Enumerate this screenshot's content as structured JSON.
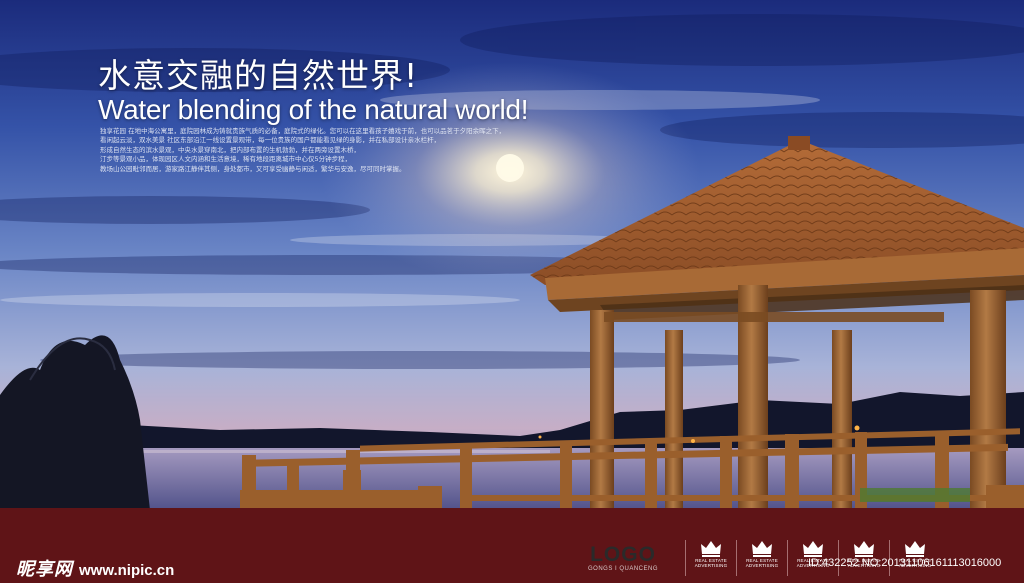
{
  "headline": {
    "title_cn": "水意交融的自然世界!",
    "title_en": "Water blending of the natural world!"
  },
  "body_text": [
    "独享花园 在地中海公寓里，庭院园林成为铸就贵族气质的必备，庭院式的绿化。您可以在这里看孩子嬉戏于前，也可以品茗于夕阳余晖之下，",
    "看闲起云淡，双水美景 社区东部沿江一线设置景观带，每一位贵族的国户都能看见绿的身影，并在私部设计亲水栏杆，",
    "形成自然生态的滨水景观，中央水景穿南北，把内部布置的生机勃勃，并在两旁设置木桥，",
    "汀步等景观小品，体现园区人文内涵和生活意境，稀有地段距离城市中心仅5分钟步程，",
    "教场山公园毗邻而居，游家路江静伴其侧，身处都市，又可享受幽静与闲适，繁华与安逸，尽可同时掌握。"
  ],
  "footer": {
    "site_cn": "昵享网",
    "site_url": "www.nipic.cn",
    "logo_word": "LOGO",
    "logo_sub": "GONGS I QUANCENG",
    "badges": [
      {
        "icon": "crown-icon",
        "label": "REAL ESTATE ADVERTISING"
      },
      {
        "icon": "crown-icon",
        "label": "REAL ESTATE ADVERTISING"
      },
      {
        "icon": "crown-icon",
        "label": "REAL ESTATE ADVERTISING"
      },
      {
        "icon": "crown-icon",
        "label": "REAL ESTATE ADVERTISING"
      },
      {
        "icon": "crown-icon",
        "label": "REAL ESTATE ADVERTISING"
      }
    ],
    "image_id": "ID:432252 NO:20131106161113016000"
  },
  "colors": {
    "sky_top": "#1c2f86",
    "sky_mid": "#5b79c2",
    "horizon": "#b8a6c8",
    "footer_bg": "#5f1417",
    "wood": "#9a5f2c",
    "roof": "#9d5a2f"
  }
}
